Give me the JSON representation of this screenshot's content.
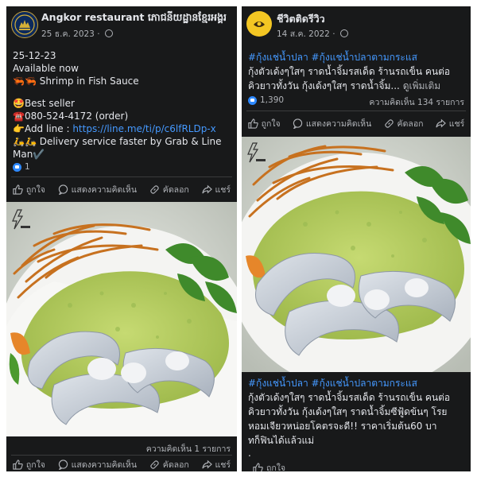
{
  "left_post": {
    "page_name": "Angkor restaurant ភោជនីយដ្ឋានខ្មែរអង្គរ",
    "date": "25 ธ.ค. 2023 · ",
    "lines": {
      "date_line": "25-12-23",
      "available": "Available now",
      "shrimp": "🦐🦐 Shrimp in Fish Sauce",
      "best_seller": "🤩Best seller",
      "phone": "☎️080-524-4172 (order)",
      "add_line_prefix": "👉Add line : ",
      "add_line_url": "https://line.me/ti/p/c6lfRLDp-x",
      "delivery_1": "🛵🛵 Delivery service faster by Grab & Line",
      "delivery_2": "Man✔️"
    },
    "reaction_count": "1",
    "comments_count": "ความคิดเห็น 1 รายการ",
    "actions": {
      "like": "ถูกใจ",
      "comment": "แสดงความคิดเห็น",
      "copy": "คัดลอก",
      "share": "แชร์"
    }
  },
  "right_post": {
    "page_name": "ชีวิตติดรีวิว",
    "date": "14 ส.ค. 2022 · ",
    "hashtags": "#กุ้งแช่น้ำปลา #กุ้งแช่น้ำปลาตามกระแส",
    "line_1": "กุ้งตัวเด้งๆใสๆ ราดน้ำจิ้มรสเด็ด ร้านรถเข็น คนต่อ",
    "line_2": "คิวยาวทั้งวัน กุ้งเด้งๆใสๆ ราดน้ำจิ้ม... ",
    "see_more": "ดูเพิ่มเติม",
    "reaction_count": "1,390",
    "comments_count": "ความคิดเห็น 134 รายการ",
    "actions": {
      "like": "ถูกใจ",
      "comment": "แสดงความคิดเห็น",
      "copy": "คัดลอก",
      "share": "แชร์"
    },
    "caption": {
      "hashtags": "#กุ้งแช่น้ำปลา #กุ้งแช่น้ำปลาตามกระแส",
      "line_1": "กุ้งตัวเด้งๆใสๆ ราดน้ำจิ้มรสเด็ด ร้านรถเข็น คนต่อ",
      "line_2": "คิวยาวทั้งวัน กุ้งเด้งๆใสๆ ราดน้ำจิ้มซีฟู้ดข้นๆ โรย",
      "line_3": "หอมเจียวหน่อยโคตรจะดี!! ราคาเริ่มต้น60 บา",
      "line_4": "ทก็ฟินได้แล้วแม่",
      "line_5": "."
    },
    "bottom_like": "ถูกใจ"
  },
  "colors": {
    "panel_bg": "#18191a",
    "text": "#e4e6eb",
    "muted": "#b0b3b8",
    "link": "#4599ff",
    "like_blue": "#2e89ff"
  },
  "icons": [
    "page-logo-icon",
    "globe-icon",
    "like-icon",
    "comment-icon",
    "copy-icon",
    "share-icon",
    "lightning-icon",
    "reaction-like-icon"
  ]
}
